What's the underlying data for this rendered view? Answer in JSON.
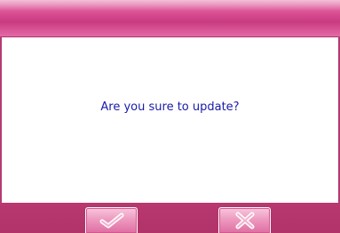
{
  "dialog": {
    "message": "Are you sure to update?"
  },
  "buttons": {
    "confirm_icon": "checkmark-icon",
    "cancel_icon": "x-icon"
  },
  "colors": {
    "accent": "#d94f92",
    "bottom_bar": "#b0336a",
    "message_text": "#1a1aa8"
  }
}
